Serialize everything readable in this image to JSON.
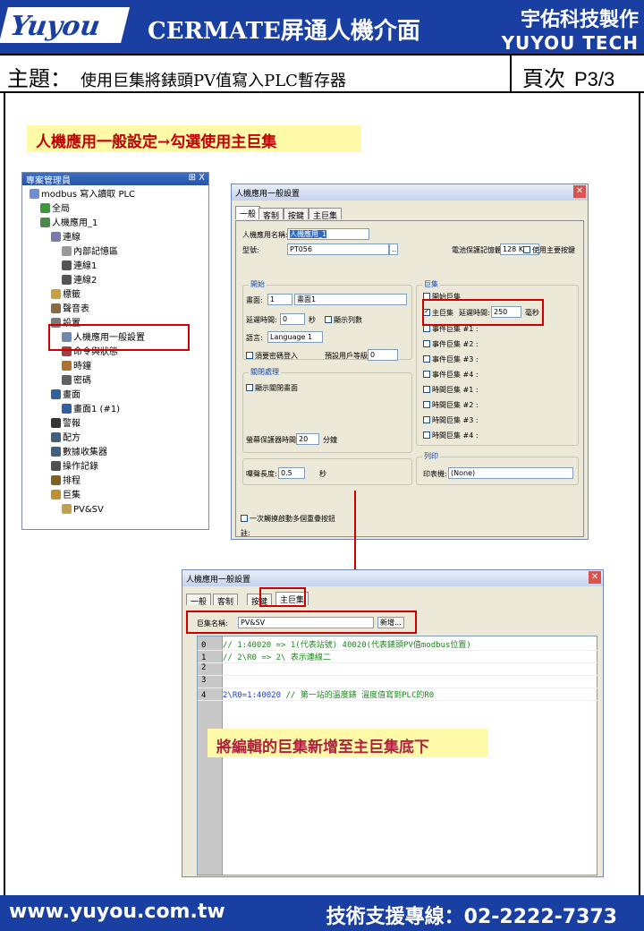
{
  "header": {
    "logo": "Yuyou",
    "title": "CERMATE屏通人機介面",
    "brand_cn": "宇佑科技製作",
    "brand_en": "YUYOU TECH"
  },
  "subject": {
    "label": "主題：",
    "text": "使用巨集將錶頭PV值寫入PLC暫存器",
    "page_label": "頁次",
    "page": "P3/3"
  },
  "note_top": "人機應用一般設定→勾選使用主巨集",
  "note_bottom": "將編輯的巨集新增至主巨集底下",
  "tree": {
    "title": "專案管理員",
    "title_icons": "⊞ X",
    "items": [
      {
        "label": "modbus 寫入讀取 PLC",
        "icon": "project-icon"
      },
      {
        "label": "全局",
        "icon": "globe-icon"
      },
      {
        "label": "人機應用_1",
        "icon": "hmi-icon"
      },
      {
        "label": "連線",
        "icon": "link-icon"
      },
      {
        "label": "內部記憶區",
        "icon": "memory-icon"
      },
      {
        "label": "連線1",
        "icon": "link-icon"
      },
      {
        "label": "連線2",
        "icon": "link-icon"
      },
      {
        "label": "標籤",
        "icon": "tag-icon"
      },
      {
        "label": "聲音表",
        "icon": "sound-icon"
      },
      {
        "label": "設置",
        "icon": "settings-icon"
      },
      {
        "label": "人機應用一般設置",
        "icon": "window-icon"
      },
      {
        "label": "命令與狀態",
        "icon": "command-icon"
      },
      {
        "label": "時鐘",
        "icon": "clock-icon"
      },
      {
        "label": "密碼",
        "icon": "lock-icon"
      },
      {
        "label": "畫面",
        "icon": "screen-icon"
      },
      {
        "label": "畫面1 (#1)",
        "icon": "screen-icon"
      },
      {
        "label": "警報",
        "icon": "alarm-icon"
      },
      {
        "label": "配方",
        "icon": "recipe-icon"
      },
      {
        "label": "數據收集器",
        "icon": "data-icon"
      },
      {
        "label": "操作記錄",
        "icon": "log-icon"
      },
      {
        "label": "排程",
        "icon": "schedule-icon"
      },
      {
        "label": "巨集",
        "icon": "macro-icon"
      },
      {
        "label": "PV&SV",
        "icon": "folder-icon"
      }
    ]
  },
  "dlg1": {
    "title": "人機應用一般設置",
    "tabs": [
      "一般",
      "客制",
      "按鍵",
      "主巨集"
    ],
    "name_label": "人機應用名稱:",
    "name_value": "人機應用_1",
    "model_label": "型號:",
    "model_value": "PT056",
    "battery_label": "電池保護記憶體:",
    "battery_value": "128 KB",
    "all_keys": "使用主要按鍵",
    "start_group": "開始",
    "screen_label": "畫面:",
    "screen_value": "1",
    "screen_name": "畫面1",
    "delay_label": "延遲時間:",
    "delay_value": "0",
    "sec": "秒",
    "show_list": "顯示列數",
    "lang_label": "語言:",
    "lang_value": "Language 1",
    "pwd": "須要密碼登入",
    "user_level": "預設用戶等級:",
    "user_level_value": "0",
    "macro_group": "巨集",
    "start_macro": "開始巨集",
    "main_macro": "主巨集",
    "macro_delay": "延遲時間:",
    "macro_delay_value": "250",
    "ms": "毫秒",
    "event_macros": [
      "事件巨集 #1 :",
      "事件巨集 #2 :",
      "事件巨集 #3 :",
      "事件巨集 #4 :"
    ],
    "time_macros": [
      "時間巨集 #1 :",
      "時間巨集 #2 :",
      "時間巨集 #3 :",
      "時間巨集 #4 :"
    ],
    "close_group": "關閉處理",
    "close_screen": "顯示關閉畫面",
    "saver_label": "螢幕保護器時間:",
    "saver_value": "20",
    "min": "分鐘",
    "print_group": "列印",
    "printer_label": "印表機:",
    "printer_value": "(None)",
    "buzz_label": "嗶聲長度:",
    "buzz_value": "0.5",
    "once": "一次觸摸啟動多個重疊按鈕",
    "note": "註:"
  },
  "dlg2": {
    "title": "人機應用一般設置",
    "tabs": [
      "一般",
      "客制",
      "按鍵",
      "主巨集"
    ],
    "macro_name_label": "巨集名稱:",
    "macro_name_value": "PV&SV",
    "new_button": "新增...",
    "lines": [
      {
        "n": "0",
        "code": "// 1:40020 =>  1(代表站號)  40020(代表錶頭PV值modbus位置)"
      },
      {
        "n": "1",
        "code": "// 2\\R0    =>  2\\ 表示連線二"
      },
      {
        "n": "2",
        "code": ""
      },
      {
        "n": "3",
        "code": ""
      },
      {
        "n": "4",
        "a": "2\\R0=1:40020",
        "c": "  // 第一站的溫度錶 溫度值寫到PLC的R0"
      }
    ]
  },
  "footer": {
    "web": "www.yuyou.com.tw",
    "phone": "技術支援專線：02-2222-7373"
  }
}
